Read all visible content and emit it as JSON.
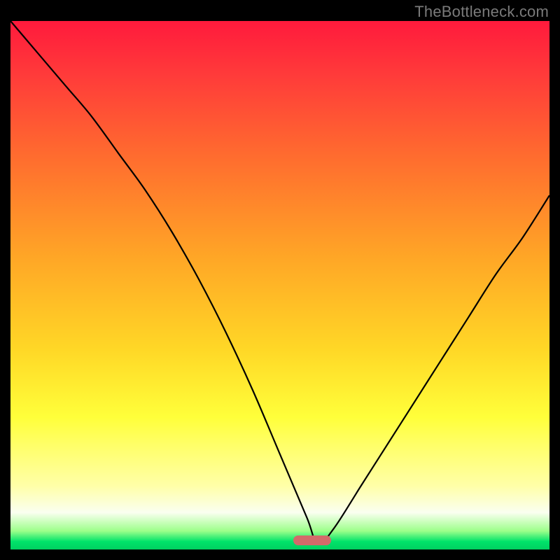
{
  "watermark": "TheBottleneck.com",
  "colors": {
    "frame": "#000000",
    "marker": "#d36a6a",
    "curve": "#000000"
  },
  "chart_data": {
    "type": "line",
    "title": "",
    "xlabel": "",
    "ylabel": "",
    "xlim": [
      0,
      100
    ],
    "ylim": [
      0,
      100
    ],
    "x": [
      0,
      5,
      10,
      15,
      20,
      25,
      30,
      35,
      40,
      45,
      50,
      55,
      57,
      60,
      65,
      70,
      75,
      80,
      85,
      90,
      95,
      100
    ],
    "values": [
      100,
      94,
      88,
      82,
      75,
      68,
      60,
      51,
      41,
      30,
      18,
      6,
      1,
      4,
      12,
      20,
      28,
      36,
      44,
      52,
      59,
      67
    ],
    "minimum_at_x": 57,
    "background_gradient": "red-to-green vertical",
    "marker": {
      "x_center": 56,
      "width_pct": 7
    }
  }
}
